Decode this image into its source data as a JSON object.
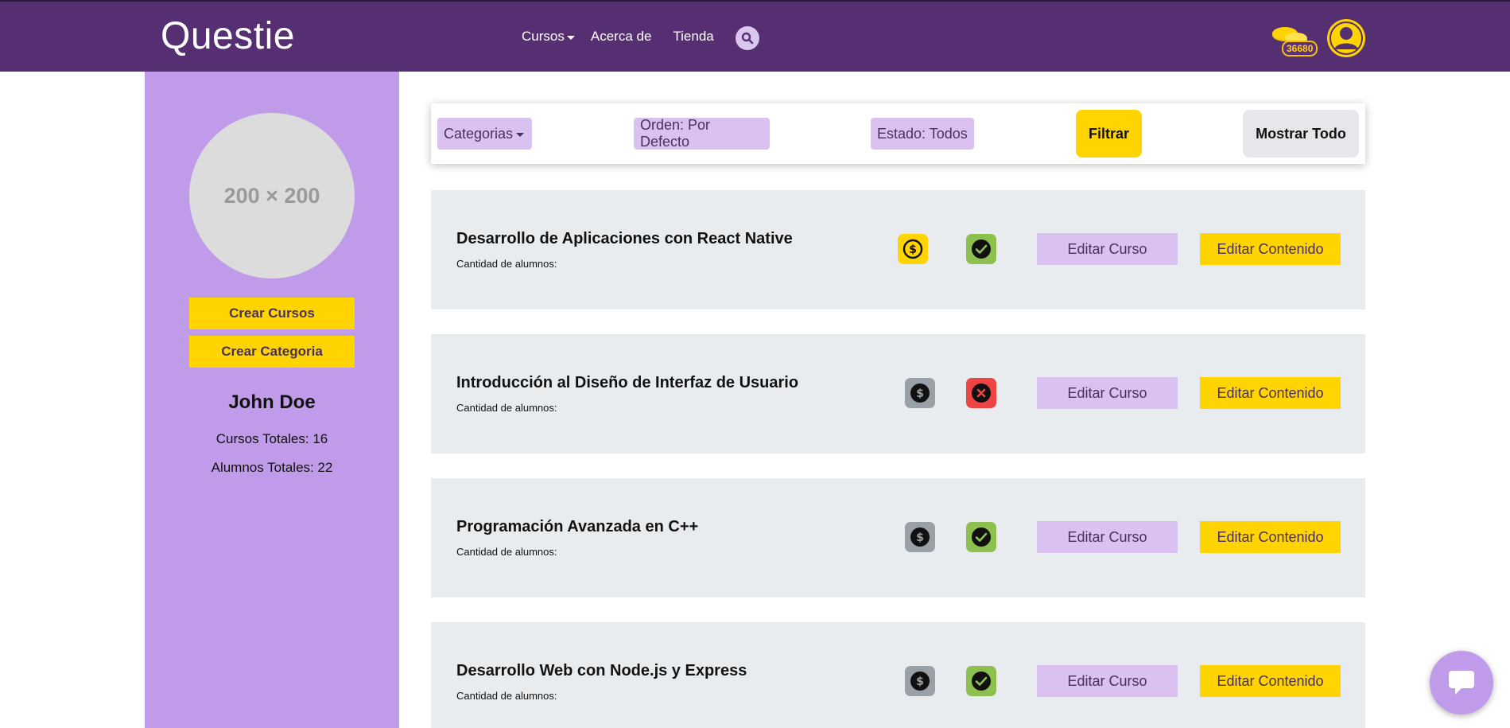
{
  "header": {
    "logo": "Questie",
    "nav": {
      "courses": "Cursos",
      "about": "Acerca de",
      "store": "Tienda"
    },
    "coins": "36680",
    "colors": {
      "bar": "#552f72",
      "accent": "#ffd400"
    }
  },
  "sidebar": {
    "profile_placeholder": "200 × 200",
    "create_courses": "Crear Cursos",
    "create_category": "Crear Categoria",
    "user_name": "John Doe",
    "total_courses": "Cursos Totales: 16",
    "total_students": "Alumnos Totales: 22"
  },
  "filters": {
    "categories": "Categorias",
    "order": "Orden: Por Defecto",
    "state": "Estado: Todos",
    "filter": "Filtrar",
    "show_all": "Mostrar Todo"
  },
  "courses": [
    {
      "title": "Desarrollo de Aplicaciones con React Native",
      "students_label": "Cantidad de alumnos:",
      "paid_icon": "dollar-circle-icon",
      "paid": true,
      "published": true,
      "edit_course": "Editar Curso",
      "edit_content": "Editar Contenido"
    },
    {
      "title": "Introducción al Diseño de Interfaz de Usuario",
      "students_label": "Cantidad de alumnos:",
      "paid_icon": "dollar-circle-icon",
      "paid": false,
      "published": false,
      "edit_course": "Editar Curso",
      "edit_content": "Editar Contenido"
    },
    {
      "title": "Programación Avanzada en C++",
      "students_label": "Cantidad de alumnos:",
      "paid_icon": "dollar-circle-icon",
      "paid": false,
      "published": true,
      "edit_course": "Editar Curso",
      "edit_content": "Editar Contenido"
    },
    {
      "title": "Desarrollo Web con Node.js y Express",
      "students_label": "Cantidad de alumnos:",
      "paid_icon": "dollar-circle-icon",
      "paid": false,
      "published": true,
      "edit_course": "Editar Curso",
      "edit_content": "Editar Contenido"
    }
  ]
}
